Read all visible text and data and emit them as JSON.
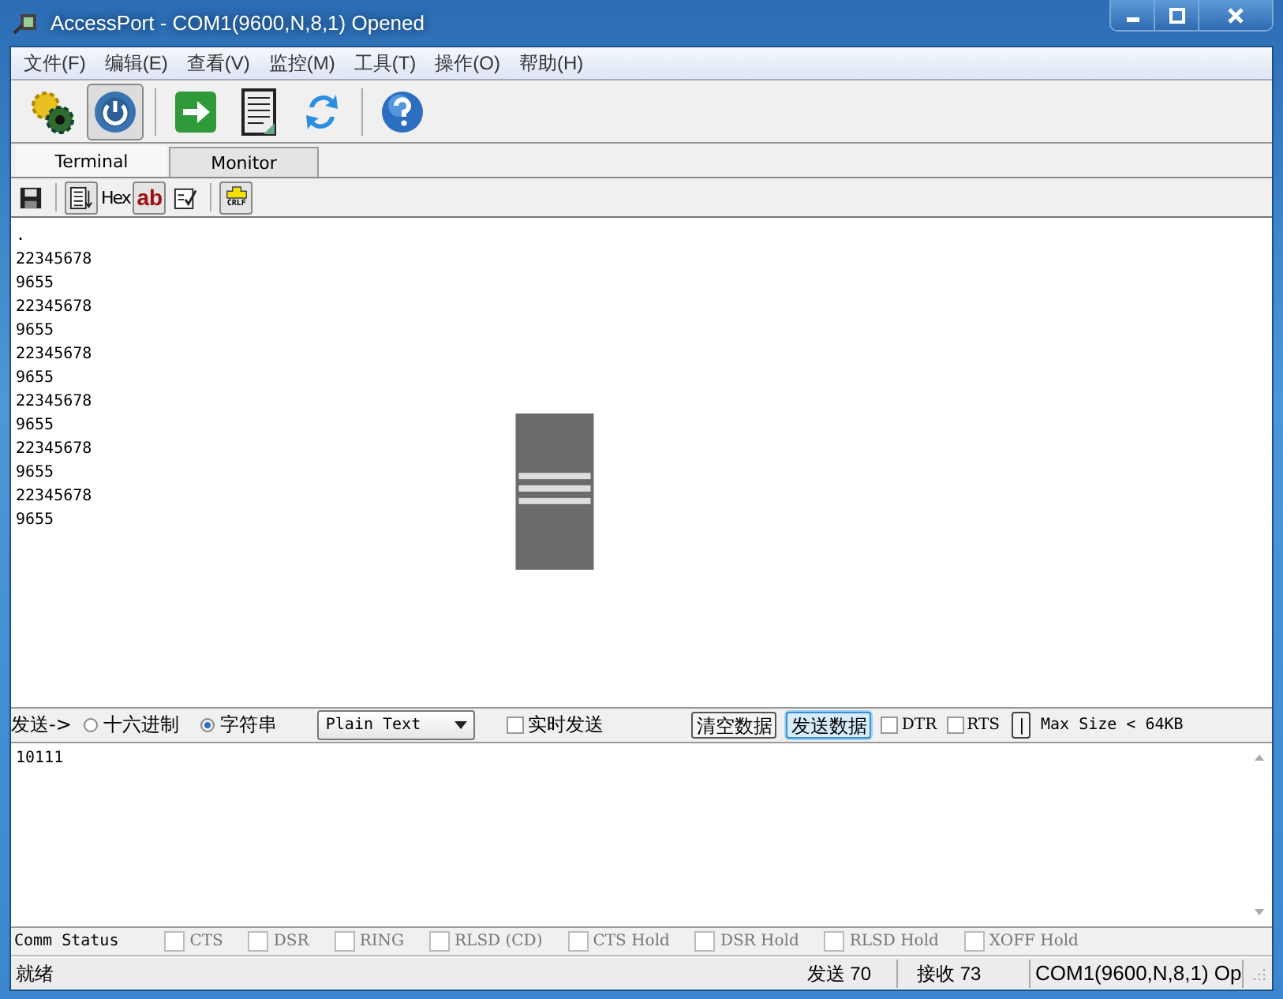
{
  "window": {
    "title": "AccessPort - COM1(9600,N,8,1) Opened"
  },
  "menu": [
    "文件(F)",
    "编辑(E)",
    "查看(V)",
    "监控(M)",
    "工具(T)",
    "操作(O)",
    "帮助(H)"
  ],
  "toolbar": [
    {
      "kind": "gears",
      "pressed": false
    },
    {
      "kind": "power",
      "pressed": true
    },
    {
      "kind": "sep"
    },
    {
      "kind": "arrow",
      "pressed": false
    },
    {
      "kind": "document",
      "pressed": false
    },
    {
      "kind": "refresh",
      "pressed": false
    },
    {
      "kind": "sep"
    },
    {
      "kind": "help",
      "pressed": false
    }
  ],
  "tabs": [
    {
      "label": "Terminal",
      "selected": true
    },
    {
      "label": "Monitor",
      "selected": false
    }
  ],
  "sub_toolbar": [
    {
      "kind": "save"
    },
    {
      "kind": "sep"
    },
    {
      "kind": "list",
      "pressed": true
    },
    {
      "kind": "text",
      "label": "Hex"
    },
    {
      "kind": "ab",
      "label": "ab",
      "pressed": true
    },
    {
      "kind": "edit"
    },
    {
      "kind": "sep"
    },
    {
      "kind": "crlf",
      "label": "CRLF",
      "pressed": true
    }
  ],
  "receive_lines": [
    ".",
    "22345678",
    "9655",
    "22345678",
    "9655",
    "22345678",
    "9655",
    "22345678",
    "9655",
    "22345678",
    "9655",
    "22345678",
    "9655"
  ],
  "send_bar": {
    "label": "发送->",
    "radios": [
      {
        "label": "十六进制",
        "selected": false
      },
      {
        "label": "字符串",
        "selected": true
      }
    ],
    "format": "Plain Text",
    "realtime": {
      "label": "实时发送",
      "checked": false
    },
    "buttons": [
      {
        "label": "清空数据",
        "focused": false
      },
      {
        "label": "发送数据",
        "focused": true
      }
    ],
    "lines": [
      {
        "label": "DTR",
        "checked": false
      },
      {
        "label": "RTS",
        "checked": false
      }
    ],
    "toggle": "|",
    "max_size": "Max Size < 64KB"
  },
  "send_text": "10111",
  "comm_status": {
    "label": "Comm Status",
    "flags": [
      {
        "label": "CTS",
        "checked": false
      },
      {
        "label": "DSR",
        "checked": false
      },
      {
        "label": "RING",
        "checked": false
      },
      {
        "label": "RLSD (CD)",
        "checked": false
      },
      {
        "label": "CTS Hold",
        "checked": false
      },
      {
        "label": "DSR Hold",
        "checked": false
      },
      {
        "label": "RLSD Hold",
        "checked": false
      },
      {
        "label": "XOFF Hold",
        "checked": false
      }
    ]
  },
  "status_bar": [
    "就绪",
    "发送 70",
    "接收 73",
    "COM1(9600,N,8,1) Op"
  ]
}
